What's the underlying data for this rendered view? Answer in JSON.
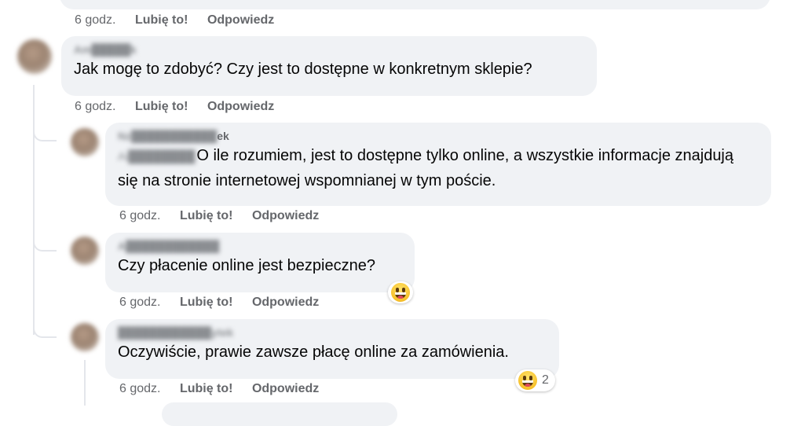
{
  "actions": {
    "time": "6 godz.",
    "like": "Lubię to!",
    "reply": "Odpowiedz"
  },
  "comments": [
    {
      "author": "Am█████k",
      "text": "Jak mogę to zdobyć? Czy jest to dostępne w konkretnym sklepie?"
    },
    {
      "author_prefix": "Nz███████████",
      "author_suffix": "ek",
      "mention": "Ai████████",
      "text": "O ile rozumiem, jest to dostępne tylko online, a wszystkie informacje znajdują się na stronie internetowej wspomnianej w tym poście."
    },
    {
      "author": "A████████████",
      "text": "Czy płacenie online jest bezpieczne?",
      "reaction": {
        "icon": "laughing-emoji-icon"
      }
    },
    {
      "author": "████████████ytek",
      "text": "Oczywiście, prawie zawsze płacę online za zamówienia.",
      "reaction": {
        "icon": "laughing-emoji-icon",
        "count": "2"
      }
    }
  ],
  "colors": {
    "bubble": "#f0f2f5",
    "muted": "#65676b",
    "line": "#e4e6eb"
  }
}
